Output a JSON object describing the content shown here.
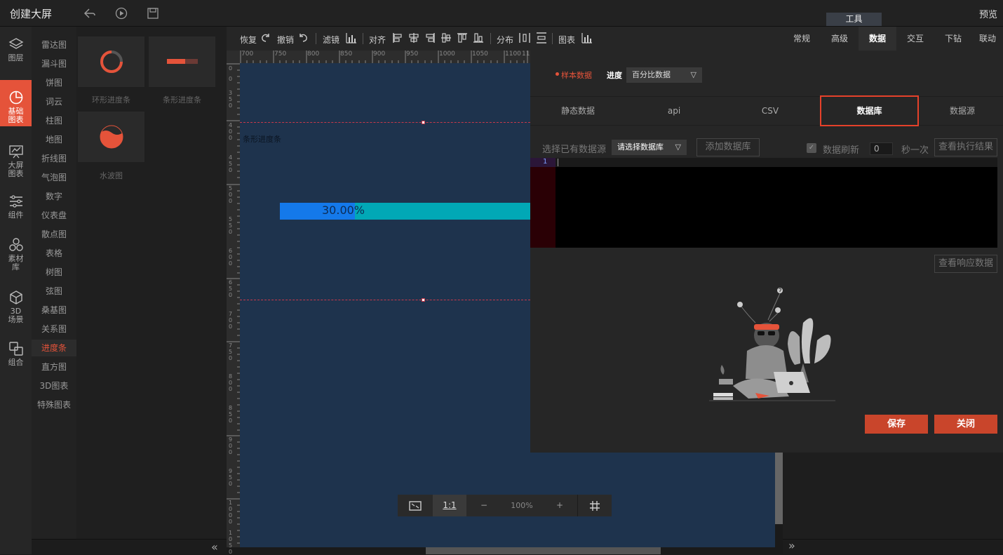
{
  "topbar": {
    "title": "创建大屏",
    "preview": "预览",
    "tools_tab": "工具"
  },
  "leftnav": {
    "items": [
      {
        "label": "图层",
        "icon": "layers-icon"
      },
      {
        "label": "基础\n图表",
        "icon": "pie-chart-icon",
        "active": true
      },
      {
        "label": "大屏\n图表",
        "icon": "screen-chart-icon"
      },
      {
        "label": "组件",
        "icon": "sliders-icon"
      },
      {
        "label": "素材\n库",
        "icon": "materials-icon"
      },
      {
        "label": "3D\n场景",
        "icon": "cube-icon"
      },
      {
        "label": "组合",
        "icon": "group-icon"
      }
    ]
  },
  "categories": [
    "雷达图",
    "漏斗图",
    "饼图",
    "词云",
    "柱图",
    "地图",
    "折线图",
    "气泡图",
    "数字",
    "仪表盘",
    "散点图",
    "表格",
    "树图",
    "弦图",
    "桑基图",
    "关系图",
    "进度条",
    "直方图",
    "3D图表",
    "特殊图表"
  ],
  "active_category": "进度条",
  "thumbnails": [
    {
      "label": "环形进度条"
    },
    {
      "label": "条形进度条"
    },
    {
      "label": "水波图"
    }
  ],
  "toolbar": {
    "restore": "恢复",
    "undo": "撤销",
    "filter": "滤镜",
    "align": "对齐",
    "distribute": "分布",
    "chart": "图表"
  },
  "ruler": {
    "top_ticks": [
      "700",
      "750",
      "800",
      "850",
      "900",
      "950",
      "1000",
      "1050",
      "1100",
      "11"
    ],
    "left_ticks": [
      "0",
      "0",
      "350",
      "400",
      "450",
      "500",
      "550",
      "600",
      "650",
      "700",
      "750",
      "800",
      "850",
      "900",
      "950",
      "1000",
      "1050"
    ]
  },
  "canvas": {
    "component_label": "条形进度条",
    "progress_text": "30.00%",
    "progress_value": 0.3,
    "fill_color": "#1479ea",
    "track_color": "#01a8b6",
    "bg_color": "#1e334d"
  },
  "zoombar": {
    "fit_label": "",
    "one_to_one": "1:1",
    "minus": "−",
    "zoom": "100%",
    "plus": "+"
  },
  "right_tabs": [
    "常规",
    "高级",
    "数据",
    "交互",
    "下钻",
    "联动"
  ],
  "active_right_tab": "数据",
  "modal": {
    "sample_data": "样本数据",
    "progress_key": "进度",
    "progress_select": "百分比数据",
    "type_tabs": [
      "静态数据",
      "api",
      "CSV",
      "数据库",
      "数据源"
    ],
    "active_type_tab": "数据库",
    "choose_source_label": "选择已有数据源",
    "db_select": "请选择数据库",
    "add_db": "添加数据库",
    "refresh_label": "数据刷新",
    "refresh_value": "0",
    "per_second": "秒一次",
    "view_result": "查看执行结果",
    "line_number": "1",
    "view_response": "查看响应数据",
    "save": "保存",
    "close": "关闭"
  },
  "colors": {
    "accent": "#e5533a",
    "highlight_border": "#e5412a",
    "save_btn": "#c9452b"
  }
}
